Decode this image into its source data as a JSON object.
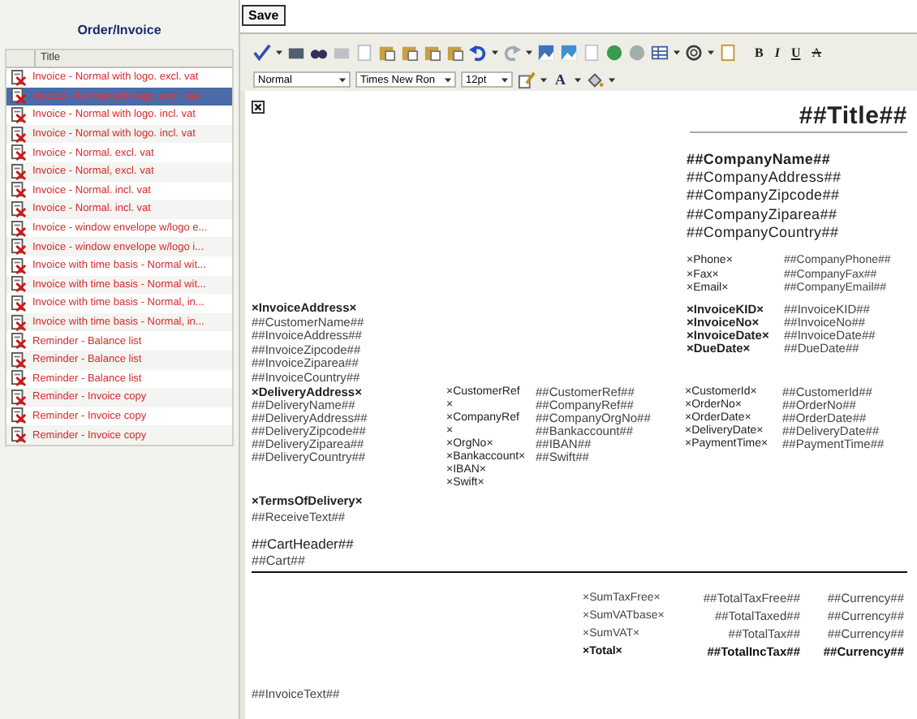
{
  "sidebar": {
    "title": "Order/Invoice",
    "column": "Title",
    "items": [
      {
        "title": "Invoice - Normal with logo. excl. vat",
        "selected": false
      },
      {
        "title": "Invoice - Normal with logo. excl. vat",
        "selected": true
      },
      {
        "title": "Invoice - Normal with logo. incl. vat",
        "selected": false
      },
      {
        "title": "Invoice - Normal with logo. incl. vat",
        "selected": false
      },
      {
        "title": "Invoice - Normal. excl. vat",
        "selected": false
      },
      {
        "title": "Invoice - Normal, excl. vat",
        "selected": false
      },
      {
        "title": "Invoice - Normal. incl. vat",
        "selected": false
      },
      {
        "title": "Invoice - Normal. incl. vat",
        "selected": false
      },
      {
        "title": "Invoice - window envelope w/logo e...",
        "selected": false
      },
      {
        "title": "Invoice - window envelope w/logo i...",
        "selected": false
      },
      {
        "title": "Invoice with time basis - Normal wit...",
        "selected": false
      },
      {
        "title": "Invoice with time basis - Normal wit...",
        "selected": false
      },
      {
        "title": "Invoice with time basis - Normal, in...",
        "selected": false
      },
      {
        "title": "Invoice with time basis - Normal, in...",
        "selected": false
      },
      {
        "title": "Reminder - Balance list",
        "selected": false
      },
      {
        "title": "Reminder - Balance list",
        "selected": false
      },
      {
        "title": "Reminder - Balance list",
        "selected": false
      },
      {
        "title": "Reminder - Invoice copy",
        "selected": false
      },
      {
        "title": "Reminder - Invoice copy",
        "selected": false
      },
      {
        "title": "Reminder - Invoice copy",
        "selected": false
      }
    ]
  },
  "save_button": "Save",
  "toolbar": {
    "format_buttons": [
      {
        "kind": "bold",
        "label": "B"
      },
      {
        "kind": "italic",
        "label": "I"
      },
      {
        "kind": "underline",
        "label": "U"
      },
      {
        "kind": "strike",
        "label": "A"
      }
    ],
    "style_select": "Normal",
    "font_select": "Times New Ron",
    "size_select": "12pt",
    "font_color_button": "A"
  },
  "document": {
    "title": "##Title##",
    "company": {
      "name": "##CompanyName##",
      "lines": [
        "##CompanyAddress##",
        "##CompanyZipcode##",
        "##CompanyZiparea##",
        "##CompanyCountry##"
      ]
    },
    "contact": [
      {
        "label": "×Phone×",
        "value": "##CompanyPhone##"
      },
      {
        "label": "×Fax×",
        "value": "##CompanyFax##"
      },
      {
        "label": "×Email×",
        "value": "##CompanyEmail##"
      }
    ],
    "invoice_info": [
      {
        "label": "×InvoiceKID×",
        "value": "##InvoiceKID##"
      },
      {
        "label": "×InvoiceNo×",
        "value": "##InvoiceNo##"
      },
      {
        "label": "×InvoiceDate×",
        "value": "##InvoiceDate##"
      },
      {
        "label": "×DueDate×",
        "value": "##DueDate##"
      }
    ],
    "invoice_address": {
      "heading": "×InvoiceAddress×",
      "lines": [
        "##CustomerName##",
        "##InvoiceAddress##",
        "##InvoiceZipcode##",
        "##InvoiceZiparea##",
        "##InvoiceCountry##"
      ]
    },
    "delivery_address": {
      "heading": "×DeliveryAddress×",
      "lines": [
        "##DeliveryName##",
        "##DeliveryAddress##",
        "##DeliveryZipcode##",
        "##DeliveryZiparea##",
        "##DeliveryCountry##"
      ]
    },
    "references": {
      "labels": [
        "×CustomerRef",
        "×",
        "×CompanyRef",
        "×",
        "×OrgNo×",
        "×Bankaccount×",
        "×IBAN×",
        "×Swift×"
      ],
      "values": [
        "##CustomerRef##",
        "##CompanyRef##",
        "##CompanyOrgNo##",
        "##Bankaccount##",
        "##IBAN##",
        "##Swift##"
      ]
    },
    "order_info": [
      {
        "label": "×CustomerId×",
        "value": "##CustomerId##"
      },
      {
        "label": "×OrderNo×",
        "value": "##OrderNo##"
      },
      {
        "label": "×OrderDate×",
        "value": "##OrderDate##"
      },
      {
        "label": "×DeliveryDate×",
        "value": "##DeliveryDate##"
      },
      {
        "label": "×PaymentTime×",
        "value": "##PaymentTime##"
      }
    ],
    "terms": {
      "heading": "×TermsOfDelivery×",
      "text": "##ReceiveText##"
    },
    "cart_header": "##CartHeader##",
    "cart": "##Cart##",
    "totals": [
      {
        "kind": "sum",
        "label": "×SumTaxFree×",
        "amount": "##TotalTaxFree##",
        "currency": "##Currency##"
      },
      {
        "kind": "sum",
        "label": "×SumVATbase×",
        "amount": "##TotalTaxed##",
        "currency": "##Currency##"
      },
      {
        "kind": "sum",
        "label": "×SumVAT×",
        "amount": "##TotalTax##",
        "currency": "##Currency##"
      },
      {
        "kind": "total",
        "label": "×Total×",
        "amount": "##TotalIncTax##",
        "currency": "##Currency##"
      }
    ],
    "invoice_text": "##InvoiceText##"
  }
}
